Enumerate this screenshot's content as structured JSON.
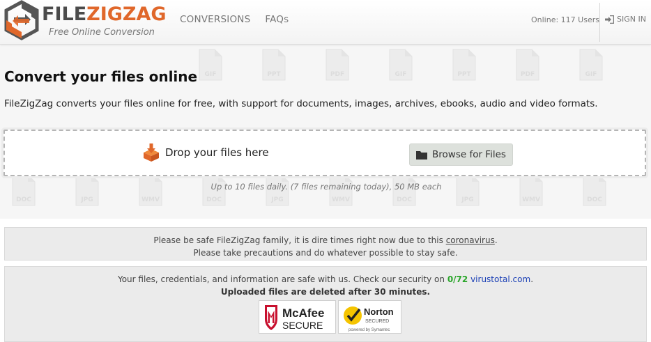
{
  "header": {
    "logo_text_a": "FILE",
    "logo_text_b": "ZIGZAG",
    "logo_sub": "Free Online Conversion",
    "nav": [
      {
        "label": "CONVERSIONS"
      },
      {
        "label": "FAQs"
      }
    ],
    "online": "Online: 117 Users",
    "signin": "SIGN IN"
  },
  "main": {
    "title": "Convert your files online",
    "description": "FileZigZag converts your files online for free, with support for documents, images, archives, ebooks, audio and video formats.",
    "drop_label": "Drop your files here",
    "browse_label": "Browse for Files",
    "limits": "Up to 10 files daily. (7 files remaining today), 50 MB each"
  },
  "pattern": {
    "row1": [
      "GIF",
      "PPT",
      "PDF",
      "GIF",
      "PPT",
      "PDF",
      "GIF"
    ],
    "row2": [
      "DOC",
      "JPG",
      "WMV",
      "DOC",
      "JPG",
      "WMV",
      "DOC",
      "JPG",
      "WMV",
      "DOC"
    ]
  },
  "notices": {
    "covid_line1_pre": "Please be safe FileZigZag family, it is dire times right now due to this ",
    "covid_link": "coronavirus",
    "covid_line1_post": ".",
    "covid_line2": "Please take precautions and do whatever possible to stay safe.",
    "security_pre": "Your files, credentials, and information are safe with us. Check our security on ",
    "security_score": "0/72",
    "security_link": "virustotal.com",
    "security_post": ".",
    "deleted": "Uploaded files are deleted after 30 minutes."
  },
  "badges": {
    "mcafee_name": "McAfee",
    "mcafee_secure": "SECURE",
    "norton_name": "Norton",
    "norton_secured": "SECURED",
    "norton_powered": "powered by Symantec"
  },
  "colors": {
    "brand_orange": "#e0672a",
    "brand_gray": "#4a4a4a",
    "link_blue": "#1a3fb5",
    "score_green": "#2aa52a"
  }
}
